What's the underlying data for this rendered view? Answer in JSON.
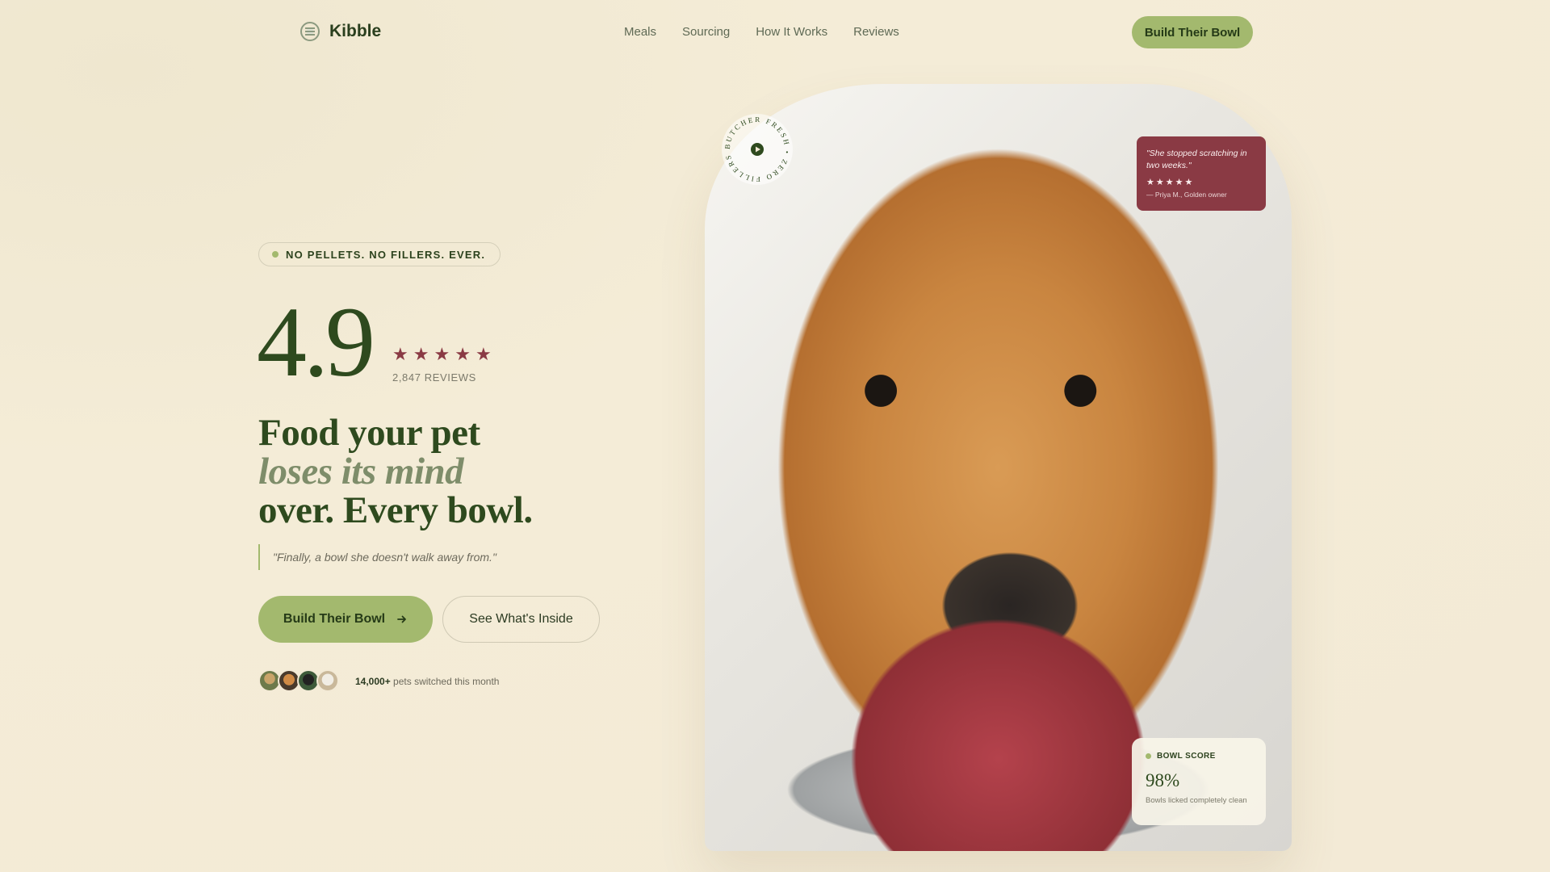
{
  "nav": {
    "brand": "Kibble",
    "brand_icon": "kibble-logo-icon",
    "links": [
      "Meals",
      "Sourcing",
      "How It Works",
      "Reviews"
    ],
    "cta": "Build Their Bowl"
  },
  "hero": {
    "pill": "NO PELLETS. NO FILLERS. EVER.",
    "rating": "4.9",
    "stars": "★★★★★",
    "review_count": "2,847 REVIEWS",
    "headline": {
      "line1": "Food your pet",
      "line2": "loses its mind",
      "line3": "over. Every bowl."
    },
    "quote": "\"Finally, a bowl she doesn't walk away from.\"",
    "primary_button": "Build Their Bowl",
    "primary_button_icon": "arrow-right-icon",
    "secondary_button": "See What's Inside",
    "switched_count": "14,000+",
    "switched_text": " pets switched this month"
  },
  "image_card": {
    "badge_text": "BUTCHER FRESH • ZERO FILLERS •",
    "badge_icon": "play-icon",
    "review": {
      "quote": "\"She stopped scratching in two weeks.\"",
      "stars": "★★★★★",
      "author": "— Priya M., Golden owner"
    },
    "score": {
      "label": "BOWL SCORE",
      "value": "98%",
      "description": "Bowls licked completely clean"
    }
  },
  "colors": {
    "background": "#f3ead6",
    "accent_green": "#a3b96e",
    "dark_green": "#2e4a1e",
    "berry": "#8a3a44"
  }
}
